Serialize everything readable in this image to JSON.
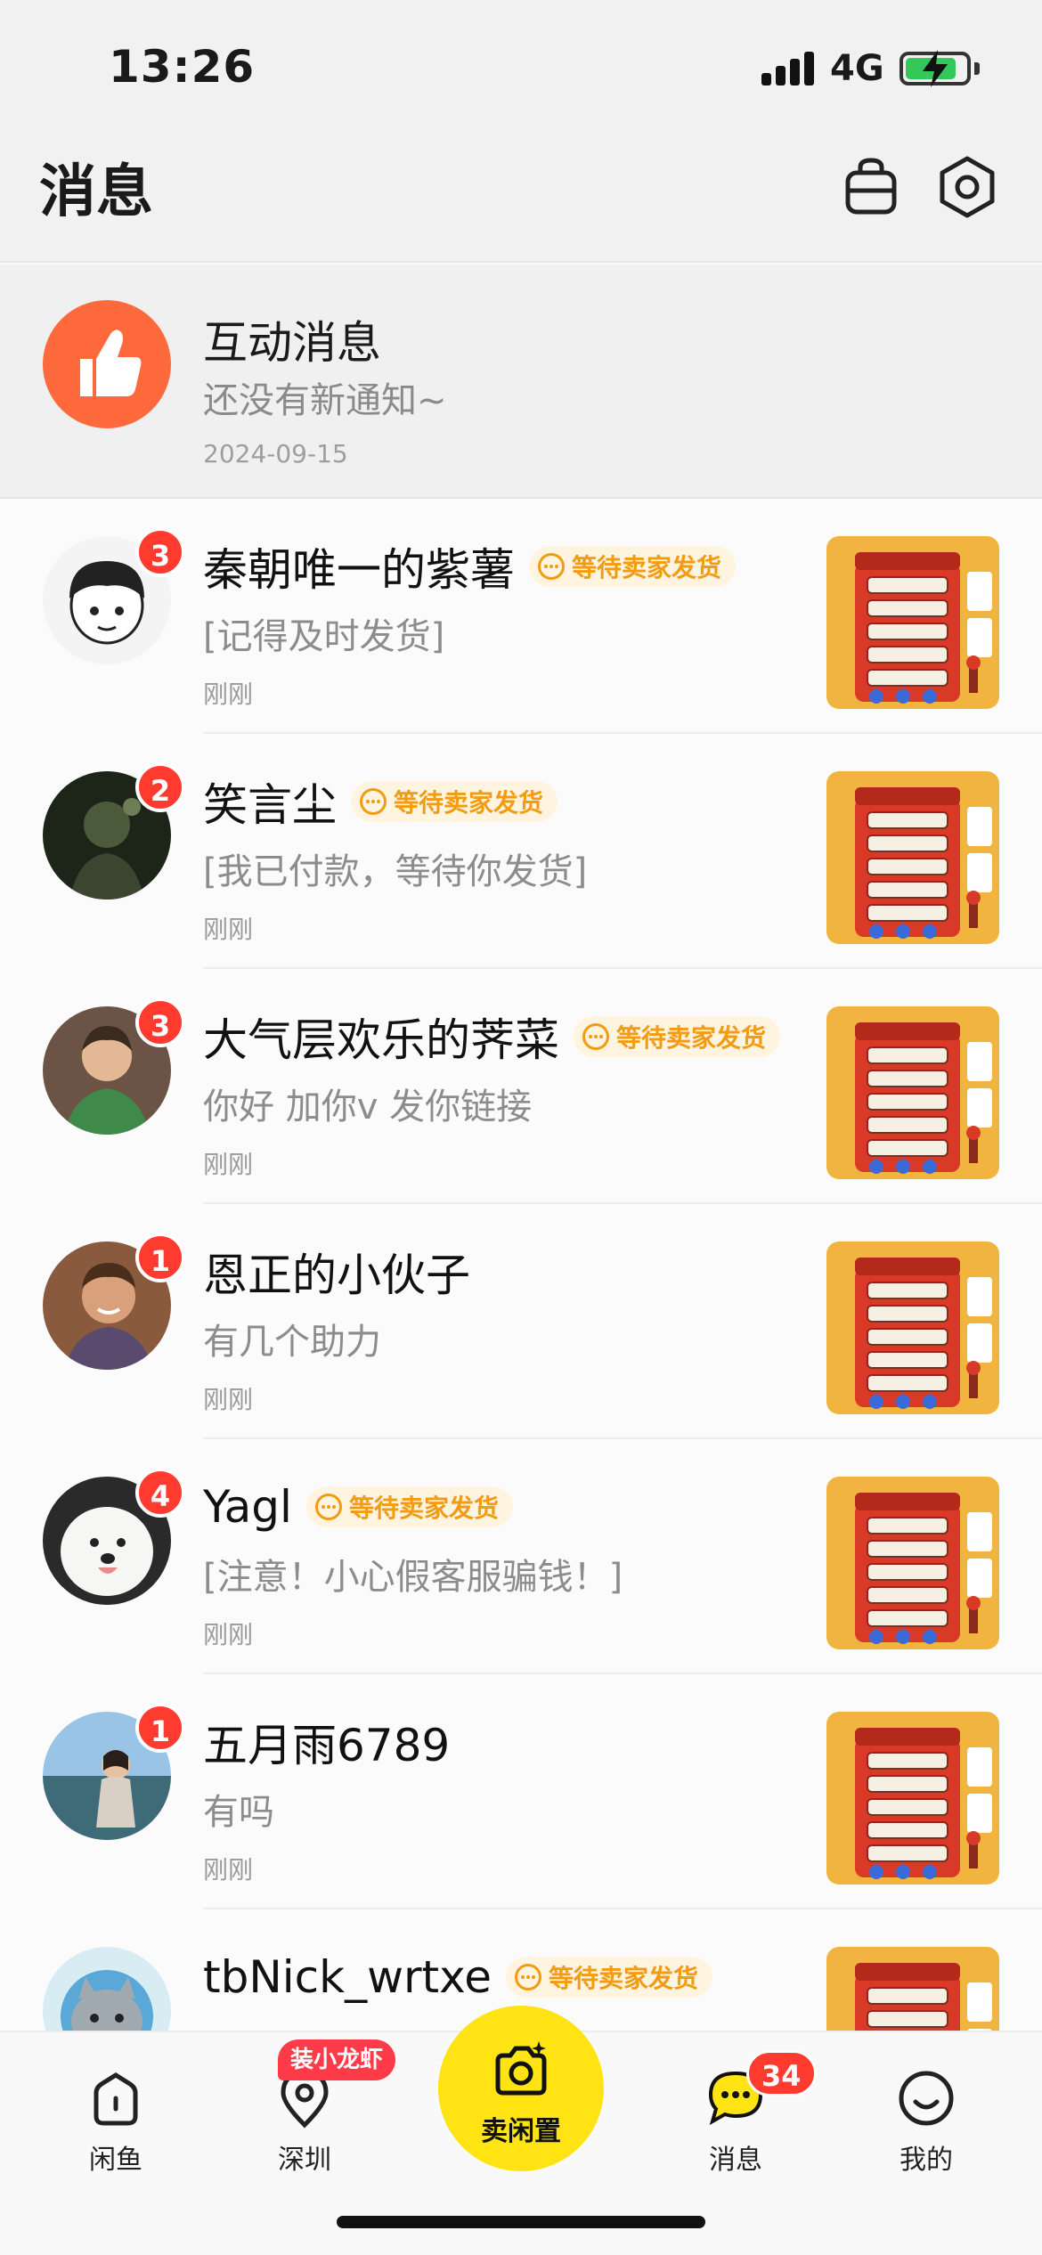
{
  "status_bar": {
    "time": "13:26",
    "network": "4G",
    "battery_fraction": 0.85
  },
  "header": {
    "title": "消息",
    "icons": [
      "shop-bag-icon",
      "settings-icon"
    ]
  },
  "interaction": {
    "title": "互动消息",
    "subtitle": "还没有新通知~",
    "date": "2024-09-15",
    "icon": "thumbs-up-icon",
    "color": "#ff6a3d"
  },
  "conversations": [
    {
      "name": "秦朝唯一的紫薯",
      "badge": "3",
      "tag": "等待卖家发货",
      "preview": "[记得及时发货]",
      "time": "刚刚"
    },
    {
      "name": "笑言尘",
      "badge": "2",
      "tag": "等待卖家发货",
      "preview": "[我已付款，等待你发货]",
      "time": "刚刚"
    },
    {
      "name": "大气层欢乐的荠菜",
      "badge": "3",
      "tag": "等待卖家发货",
      "preview": "你好 加你v 发你链接",
      "time": "刚刚"
    },
    {
      "name": "恩正的小伙子",
      "badge": "1",
      "tag": "",
      "preview": "有几个助力",
      "time": "刚刚"
    },
    {
      "name": "Yagl",
      "badge": "4",
      "tag": "等待卖家发货",
      "preview": "[注意！小心假客服骗钱！]",
      "time": "刚刚"
    },
    {
      "name": "五月雨6789",
      "badge": "1",
      "tag": "",
      "preview": "有吗",
      "time": "刚刚"
    },
    {
      "name": "tbNick_wrtxe",
      "badge": "",
      "tag": "等待卖家发货",
      "preview": "",
      "time": ""
    }
  ],
  "tabbar": {
    "tabs": [
      {
        "label": "闲鱼",
        "icon": "home-icon"
      },
      {
        "label": "深圳",
        "icon": "location-icon",
        "promo": "装小龙虾"
      },
      {
        "label": "卖闲置",
        "icon": "camera-icon"
      },
      {
        "label": "消息",
        "icon": "chat-icon",
        "badge": "34"
      },
      {
        "label": "我的",
        "icon": "smile-icon"
      }
    ]
  },
  "colors": {
    "accent": "#ffe313",
    "badge": "#ff3b30",
    "tag_text": "#f39b12",
    "tag_bg": "#fff4e0"
  }
}
